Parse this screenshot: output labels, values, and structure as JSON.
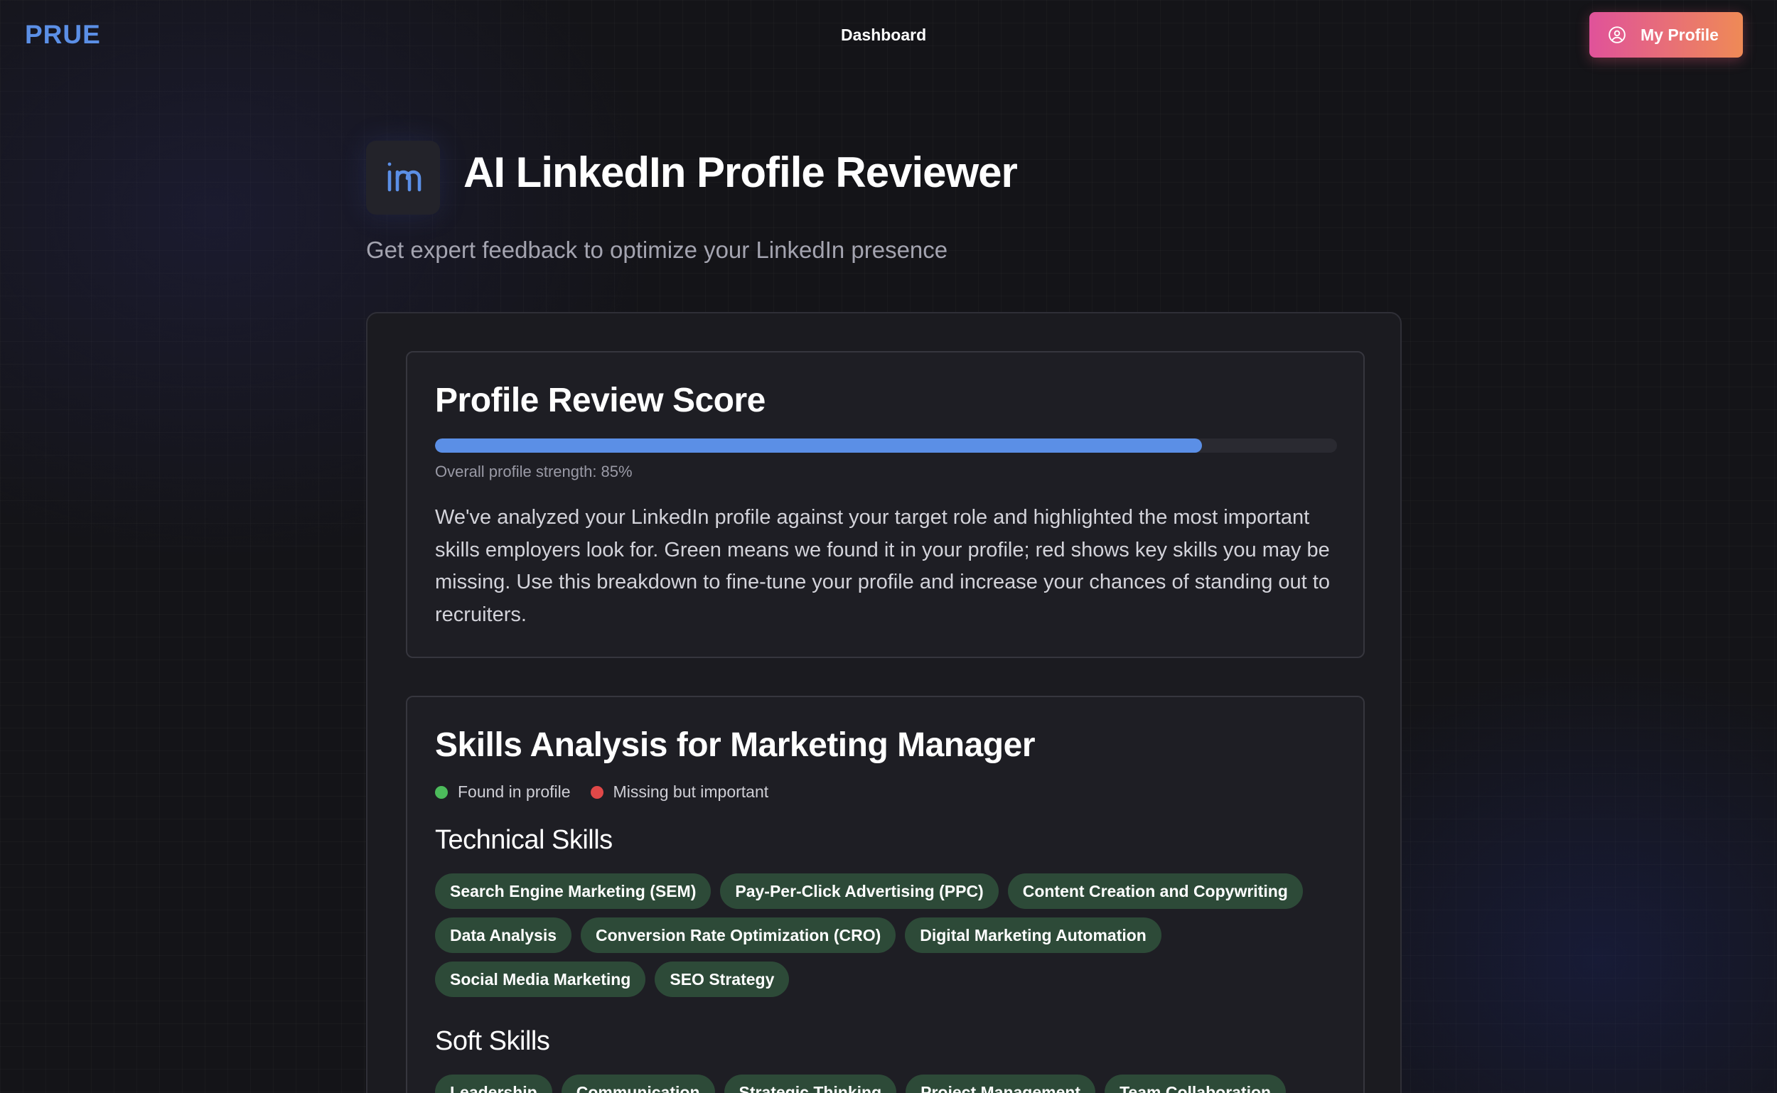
{
  "header": {
    "brand": "PRUE",
    "nav_dashboard": "Dashboard",
    "profile_button_label": "My Profile"
  },
  "hero": {
    "title": "AI LinkedIn Profile Reviewer",
    "subtitle": "Get expert feedback to optimize your LinkedIn presence"
  },
  "score_card": {
    "title": "Profile Review Score",
    "progress_percent": 85,
    "strength_label": "Overall profile strength: ",
    "strength_value": "85%",
    "description": "We've analyzed your LinkedIn profile against your target role and highlighted the most important skills employers look for. Green means we found it in your profile; red shows key skills you may be missing. Use this breakdown to fine-tune your profile and increase your chances of standing out to recruiters."
  },
  "skills_card": {
    "title": "Skills Analysis for Marketing Manager",
    "legend": {
      "found_label": "Found in profile",
      "missing_label": "Missing but important"
    },
    "technical_heading": "Technical Skills",
    "technical_skills": [
      "Search Engine Marketing (SEM)",
      "Pay-Per-Click Advertising (PPC)",
      "Content Creation and Copywriting",
      "Data Analysis",
      "Conversion Rate Optimization (CRO)",
      "Digital Marketing Automation",
      "Social Media Marketing",
      "SEO Strategy"
    ],
    "soft_heading": "Soft Skills",
    "soft_skills": [
      "Leadership",
      "Communication",
      "Strategic Thinking",
      "Project Management",
      "Team Collaboration"
    ]
  },
  "colors": {
    "brand": "#5b8fe6",
    "progress_fill": "#5b8fe6",
    "found": "#4cbb5b",
    "missing": "#e04848",
    "tag_found_bg": "#2d4a38",
    "button_gradient_start": "#e0529a",
    "button_gradient_end": "#ef8a56"
  },
  "icons": {
    "hero": "linkedin-icon",
    "profile_button": "user-circle-icon"
  }
}
